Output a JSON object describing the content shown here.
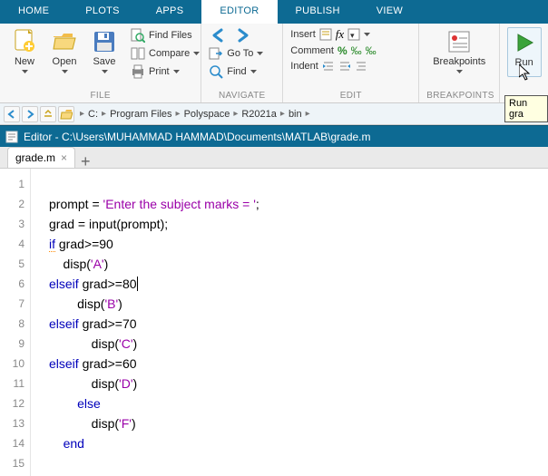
{
  "tabs": {
    "home": "HOME",
    "plots": "PLOTS",
    "apps": "APPS",
    "editor": "EDITOR",
    "publish": "PUBLISH",
    "view": "VIEW"
  },
  "toolstrip": {
    "file": {
      "group_label": "FILE",
      "new": "New",
      "open": "Open",
      "save": "Save",
      "find_files": "Find Files",
      "compare": "Compare",
      "print": "Print"
    },
    "navigate": {
      "group_label": "NAVIGATE",
      "go_to": "Go To",
      "find": "Find"
    },
    "edit": {
      "group_label": "EDIT",
      "insert": "Insert",
      "comment": "Comment",
      "indent": "Indent"
    },
    "breakpoints": {
      "group_label": "BREAKPOINTS",
      "label": "Breakpoints"
    },
    "run": {
      "label": "Run"
    }
  },
  "address": {
    "segs": [
      "C:",
      "Program Files",
      "Polyspace",
      "R2021a",
      "bin"
    ]
  },
  "editor_title": "Editor - C:\\Users\\MUHAMMAD HAMMAD\\Documents\\MATLAB\\grade.m",
  "doc_tab": "grade.m",
  "tooltip": "Run gra",
  "code": {
    "lines": [
      {
        "n": 1,
        "text": ""
      },
      {
        "n": 2,
        "text": "prompt = 'Enter the subject marks = ';"
      },
      {
        "n": 3,
        "text": "grad = input(prompt);"
      },
      {
        "n": 4,
        "text": "if grad>=90"
      },
      {
        "n": 5,
        "text": "    disp('A')"
      },
      {
        "n": 6,
        "text": "elseif grad>=80"
      },
      {
        "n": 7,
        "text": "        disp('B')"
      },
      {
        "n": 8,
        "text": "elseif grad>=70"
      },
      {
        "n": 9,
        "text": "            disp('C')"
      },
      {
        "n": 10,
        "text": "elseif grad>=60"
      },
      {
        "n": 11,
        "text": "            disp('D')"
      },
      {
        "n": 12,
        "text": "        else"
      },
      {
        "n": 13,
        "text": "            disp('F')"
      },
      {
        "n": 14,
        "text": "    end"
      },
      {
        "n": 15,
        "text": ""
      }
    ]
  }
}
